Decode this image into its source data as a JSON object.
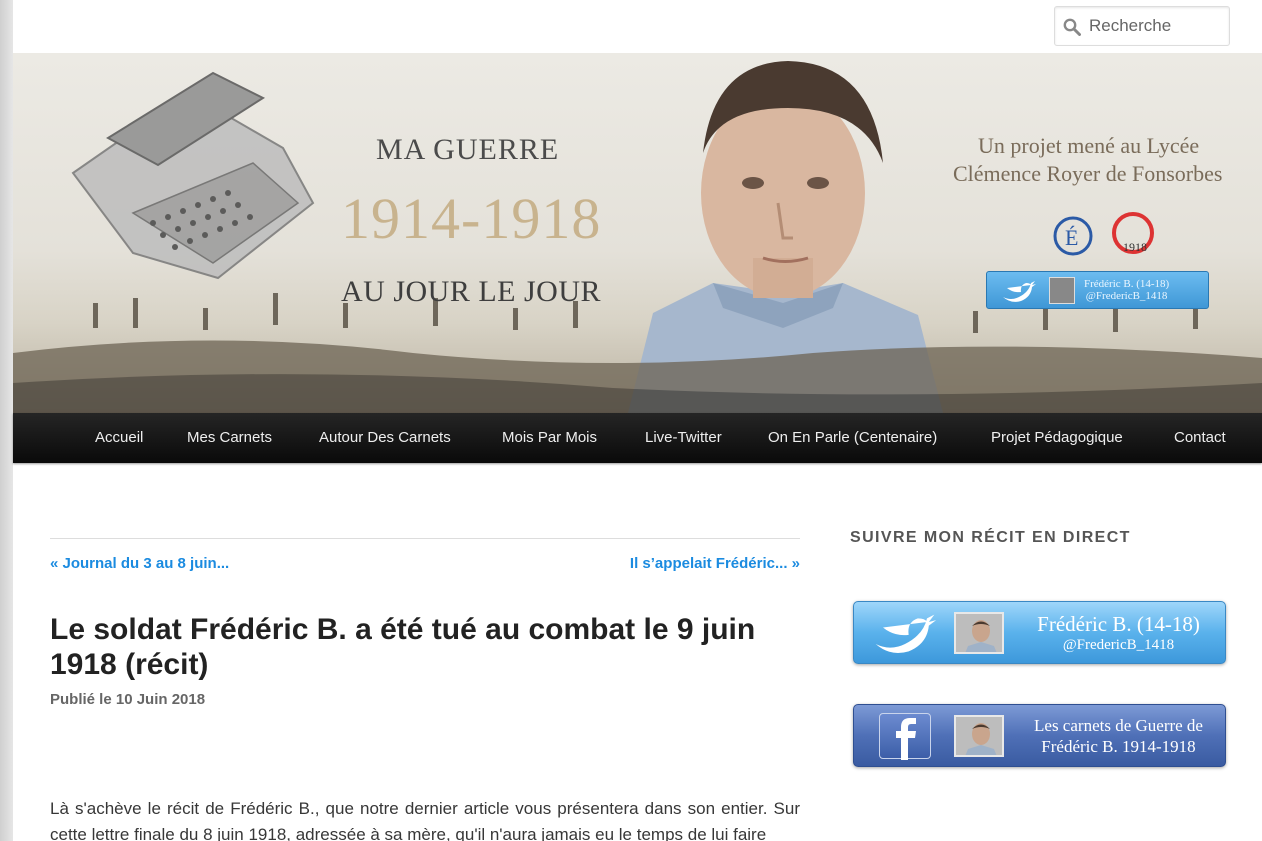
{
  "search": {
    "placeholder": "Recherche"
  },
  "banner": {
    "title_line1": "MA GUERRE",
    "years": "1914-1918",
    "title_line2": "AU JOUR LE JOUR",
    "project_line1": "Un projet mené au Lycée",
    "project_line2": "Clémence Royer de Fonsorbes",
    "twitter_name": "Frédéric B. (14-18)",
    "twitter_handle": "@FredericB_1418"
  },
  "nav": {
    "items": [
      {
        "label": "Accueil"
      },
      {
        "label": "Mes Carnets"
      },
      {
        "label": "Autour Des Carnets"
      },
      {
        "label": "Mois Par Mois"
      },
      {
        "label": "Live-Twitter"
      },
      {
        "label": "On En Parle (Centenaire)"
      },
      {
        "label": "Projet Pédagogique"
      },
      {
        "label": "Contact"
      }
    ]
  },
  "post": {
    "prev": "« Journal du 3 au 8 juin...",
    "next": "Il s’appelait Frédéric... »",
    "title": "Le soldat Frédéric B. a été tué au combat le 9 juin 1918 (récit)",
    "meta_prefix": "Publié le ",
    "date": "10 Juin 2018",
    "body": "Là s'achève le récit de Frédéric B., que notre dernier article vous présentera dans son entier. Sur cette lettre finale du 8 juin 1918, adressée à sa mère, qu'il n'aura jamais eu le temps de lui faire"
  },
  "sidebar": {
    "widget_title": "Suivre mon récit en direct",
    "twitter": {
      "line1": "Frédéric B. (14-18)",
      "line2": "@FredericB_1418"
    },
    "facebook": {
      "line1": "Les carnets de Guerre de",
      "line2": "Frédéric B. 1914-1918"
    }
  },
  "colors": {
    "link": "#1b8be0",
    "nav_bg": "#111111",
    "twitter_blue": "#3d98db",
    "facebook_blue": "#3a5ba1"
  }
}
